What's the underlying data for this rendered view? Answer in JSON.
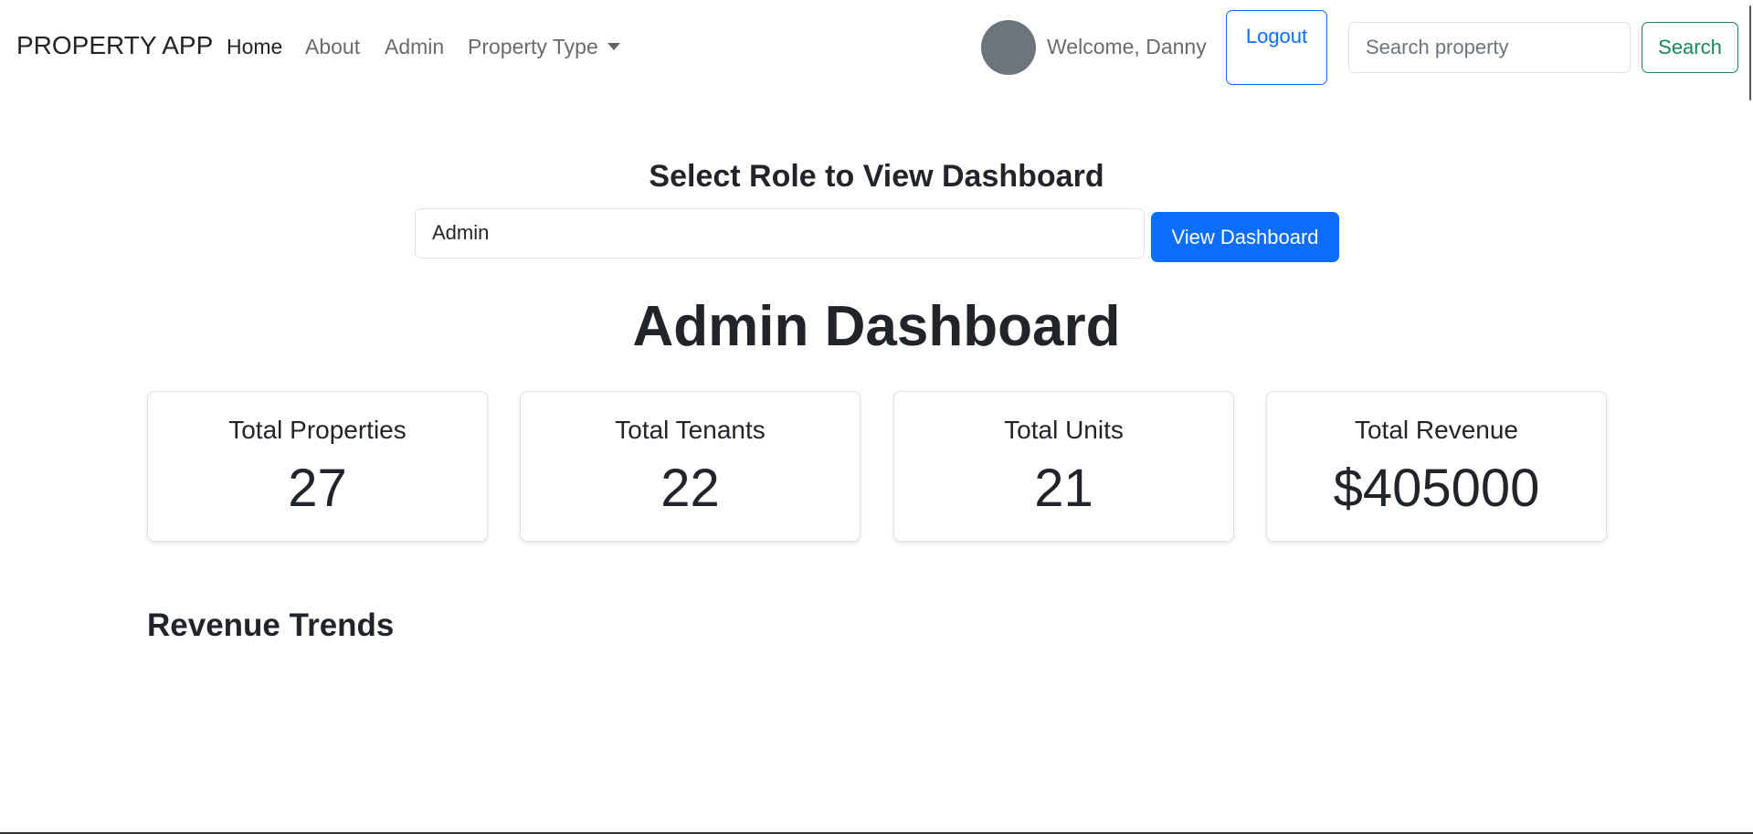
{
  "navbar": {
    "brand": "PROPERTY APP",
    "links": [
      {
        "label": "Home"
      },
      {
        "label": "About"
      },
      {
        "label": "Admin"
      },
      {
        "label": "Property Type"
      }
    ],
    "welcome": "Welcome, Danny",
    "logout_label": "Logout",
    "search_placeholder": "Search property",
    "search_label": "Search"
  },
  "role_selector": {
    "title": "Select Role to View Dashboard",
    "selected_role": "Admin",
    "button_label": "View Dashboard"
  },
  "dashboard": {
    "title": "Admin Dashboard",
    "cards": [
      {
        "title": "Total Properties",
        "value": "27"
      },
      {
        "title": "Total Tenants",
        "value": "22"
      },
      {
        "title": "Total Units",
        "value": "21"
      },
      {
        "title": "Total Revenue",
        "value": "$405000"
      }
    ],
    "section_title": "Revenue Trends"
  },
  "colors": {
    "primary": "#0d6efd",
    "success": "#198754",
    "avatar": "#6c757d",
    "text": "#212529"
  }
}
